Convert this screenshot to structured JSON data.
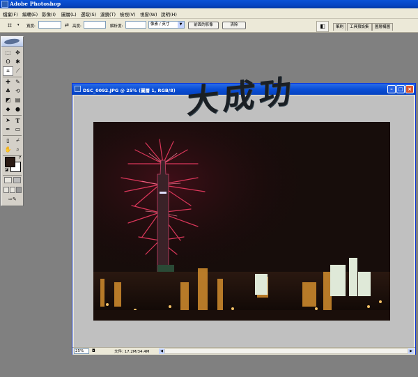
{
  "app": {
    "title": "Adobe Photoshop"
  },
  "menu": [
    {
      "label": "檔案(F)"
    },
    {
      "label": "編輯(E)"
    },
    {
      "label": "影像(I)"
    },
    {
      "label": "圖層(L)"
    },
    {
      "label": "選取(S)"
    },
    {
      "label": "濾鏡(T)"
    },
    {
      "label": "檢視(V)"
    },
    {
      "label": "視窗(W)"
    },
    {
      "label": "說明(H)"
    }
  ],
  "options": {
    "tool_icon": "crop-icon",
    "width_label": "寬度:",
    "height_label": "高度:",
    "resolution_label": "解析度:",
    "units_value": "像素 / 英寸",
    "front_image_button": "前面的影像",
    "clear_button": "清除",
    "well_tabs": [
      {
        "label": "筆刷"
      },
      {
        "label": "工具預設集"
      },
      {
        "label": "圖層構圖"
      }
    ]
  },
  "toolbox": {
    "tools": [
      {
        "icon": "marquee-icon",
        "glyph": "⬚"
      },
      {
        "icon": "move-icon",
        "glyph": "✥"
      },
      {
        "icon": "lasso-icon",
        "glyph": "ʘ"
      },
      {
        "icon": "magic-wand-icon",
        "glyph": "✱"
      },
      {
        "icon": "crop-tool-icon",
        "glyph": "⌗"
      },
      {
        "icon": "slice-icon",
        "glyph": "⟋"
      },
      {
        "icon": "healing-brush-icon",
        "glyph": "✚"
      },
      {
        "icon": "brush-icon",
        "glyph": "✎"
      },
      {
        "icon": "clone-stamp-icon",
        "glyph": "♣"
      },
      {
        "icon": "history-brush-icon",
        "glyph": "⟲"
      },
      {
        "icon": "eraser-icon",
        "glyph": "◩"
      },
      {
        "icon": "gradient-icon",
        "glyph": "▤"
      },
      {
        "icon": "blur-icon",
        "glyph": "◆"
      },
      {
        "icon": "dodge-icon",
        "glyph": "●"
      },
      {
        "icon": "path-select-icon",
        "glyph": "➤"
      },
      {
        "icon": "type-icon",
        "glyph": "T"
      },
      {
        "icon": "pen-icon",
        "glyph": "✒"
      },
      {
        "icon": "shape-icon",
        "glyph": "▭"
      },
      {
        "icon": "notes-icon",
        "glyph": "▯"
      },
      {
        "icon": "eyedropper-icon",
        "glyph": "⌿"
      },
      {
        "icon": "hand-icon",
        "glyph": "✋"
      },
      {
        "icon": "zoom-icon",
        "glyph": "⌕"
      }
    ]
  },
  "document": {
    "title": "DSC_0092.JPG @ 25% (圖層 1, RGB/8)",
    "zoom": "25%",
    "doc_size": "文件: 17.2M/34.4M",
    "overlay_text": "大成功"
  },
  "colors": {
    "titlebar": "#0a52d6",
    "workspace": "#808080",
    "firework": "#e8345a"
  }
}
